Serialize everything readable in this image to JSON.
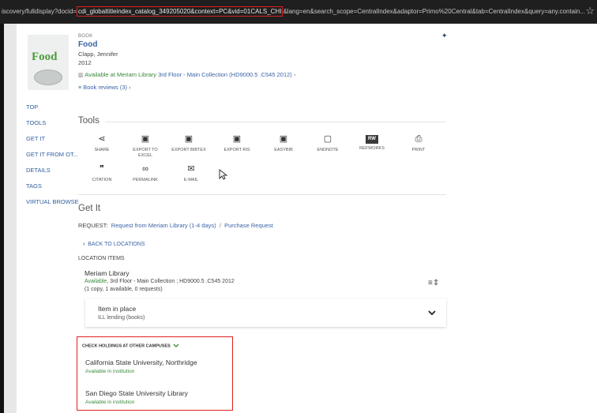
{
  "browser": {
    "url_prefix": "iscovery/fulldisplay?docid=",
    "url_highlight": "cdi_globaltitleindex_catalog_349205020&context=PC&vid=01CALS_CHI",
    "url_suffix": "&lang=en&search_scope=CentralIndex&adaptor=Primo%20Central&tab=CentralIndex&query=any.contain...",
    "star_glyph": "☆"
  },
  "record": {
    "cover_title": "Food",
    "type": "BOOK",
    "title": "Food",
    "author": "Clapp, Jennifer",
    "year": "2012",
    "availability_status": "Available at Meriam Library",
    "availability_location": "3rd Floor - Main Collection  (HD9000.5 .C545 2012)",
    "availability_arrow": "›",
    "reviews": "Book reviews (3)",
    "reviews_arrow": "›"
  },
  "nav": [
    "TOP",
    "TOOLS",
    "GET IT",
    "GET IT FROM OT...",
    "DETAILS",
    "TAGS",
    "VIRTUAL BROWSE"
  ],
  "tools": {
    "heading": "Tools",
    "items": [
      {
        "label": "SHARE",
        "icon": "share-icon",
        "glyph": "⋖"
      },
      {
        "label": "EXPORT TO EXCEL",
        "icon": "excel-icon",
        "glyph": "▣"
      },
      {
        "label": "EXPORT BIBTEX",
        "icon": "bibtex-icon",
        "glyph": "▣"
      },
      {
        "label": "EXPORT RIS",
        "icon": "ris-icon",
        "glyph": "▣"
      },
      {
        "label": "EASYBIB",
        "icon": "easybib-icon",
        "glyph": "▣"
      },
      {
        "label": "ENDNOTE",
        "icon": "endnote-icon",
        "glyph": "▢"
      },
      {
        "label": "REFWORKS",
        "icon": "refworks-icon",
        "glyph": "RW"
      },
      {
        "label": "PRINT",
        "icon": "print-icon",
        "glyph": "⎙"
      },
      {
        "label": "CITATION",
        "icon": "citation-icon",
        "glyph": "❞"
      },
      {
        "label": "PERMALINK",
        "icon": "link-icon",
        "glyph": "∞"
      },
      {
        "label": "E-MAIL",
        "icon": "email-icon",
        "glyph": "✉"
      }
    ]
  },
  "get_it": {
    "heading": "Get It",
    "request_label": "REQUEST:",
    "request_link": "Request from Meriam Library (1-4 days)",
    "separator": "/",
    "purchase_link": "Purchase Request",
    "back_label": "BACK TO LOCATIONS",
    "location_items_label": "LOCATION ITEMS",
    "library_name": "Meriam Library",
    "library_status": "Available",
    "library_details": ", 3rd Floor - Main Collection ; HD9000.5 .C545 2012",
    "copies": "(1 copy, 1 available, 0 requests)",
    "item_status": "Item in place",
    "item_policy": "ILL lending (books)"
  },
  "other_campuses": {
    "heading": "CHECK HOLDINGS AT OTHER CAMPUSES",
    "campuses": [
      {
        "name": "California State University, Northridge",
        "status": "Available in institution"
      },
      {
        "name": "San Diego State University Library",
        "status": "Available in institution"
      }
    ]
  }
}
